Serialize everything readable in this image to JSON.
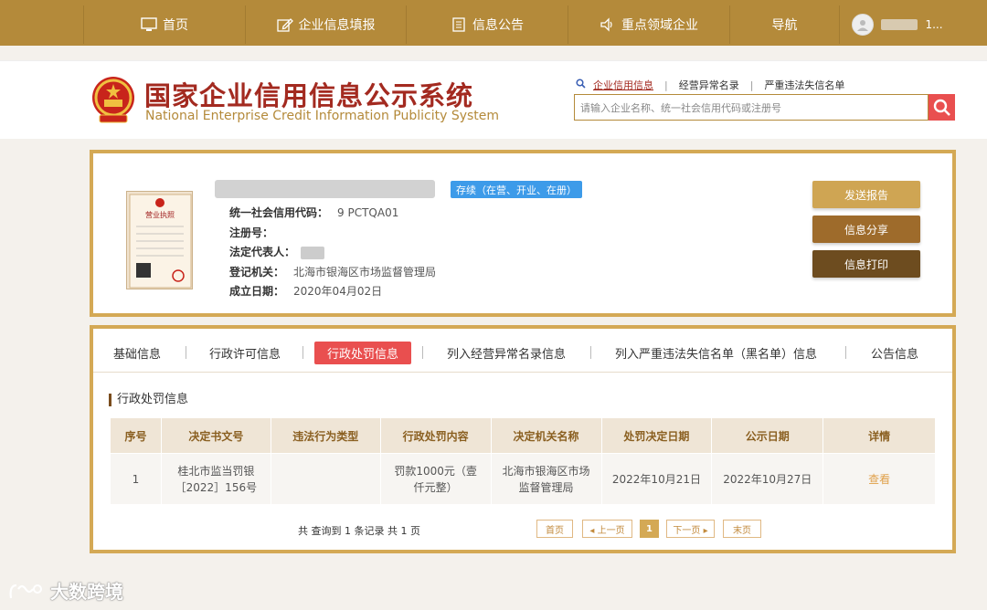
{
  "nav": {
    "items": [
      {
        "label": "首页",
        "icon": "monitor-icon"
      },
      {
        "label": "企业信息填报",
        "icon": "edit-icon"
      },
      {
        "label": "信息公告",
        "icon": "document-icon"
      },
      {
        "label": "重点领域企业",
        "icon": "speaker-icon"
      },
      {
        "label": "导航",
        "icon": ""
      }
    ],
    "user_name": "1..."
  },
  "header": {
    "title_cn": "国家企业信用信息公示系统",
    "title_en": "National Enterprise Credit Information Publicity System",
    "search_tabs": [
      "企业信用信息",
      "经营异常名录",
      "严重违法失信名单"
    ],
    "search_placeholder": "请输入企业名称、统一社会信用代码或注册号"
  },
  "company": {
    "status": "存续（在营、开业、在册）",
    "labels": {
      "credit_code": "统一社会信用代码：",
      "reg_no": "注册号：",
      "legal_rep": "法定代表人：",
      "authority": "登记机关：",
      "founded": "成立日期："
    },
    "credit_code": "9                 PCTQA01",
    "reg_no": "",
    "legal_rep": "",
    "authority": "北海市银海区市场监督管理局",
    "founded": "2020年04月02日",
    "license_title": "营业执照"
  },
  "actions": {
    "send_report": "发送报告",
    "share": "信息分享",
    "print": "信息打印"
  },
  "tabs": [
    "基础信息",
    "行政许可信息",
    "行政处罚信息",
    "列入经营异常名录信息",
    "列入严重违法失信名单（黑名单）信息",
    "公告信息"
  ],
  "section_title": "行政处罚信息",
  "table": {
    "headers": [
      "序号",
      "决定书文号",
      "违法行为类型",
      "行政处罚内容",
      "决定机关名称",
      "处罚决定日期",
      "公示日期",
      "详情"
    ],
    "rows": [
      {
        "no": "1",
        "doc_no": "桂北市监当罚银［2022］156号",
        "type": "",
        "content": "罚款1000元（壹仟元整）",
        "authority": "北海市银海区市场监督管理局",
        "decision_date": "2022年10月21日",
        "publish_date": "2022年10月27日",
        "detail": "查看"
      }
    ]
  },
  "pager": {
    "summary": "共 查询到 1 条记录 共 1 页",
    "first": "首页",
    "prev": "◂ 上一页",
    "current": "1",
    "next": "下一页 ▸",
    "last": "末页"
  },
  "watermark": "大数跨境"
}
